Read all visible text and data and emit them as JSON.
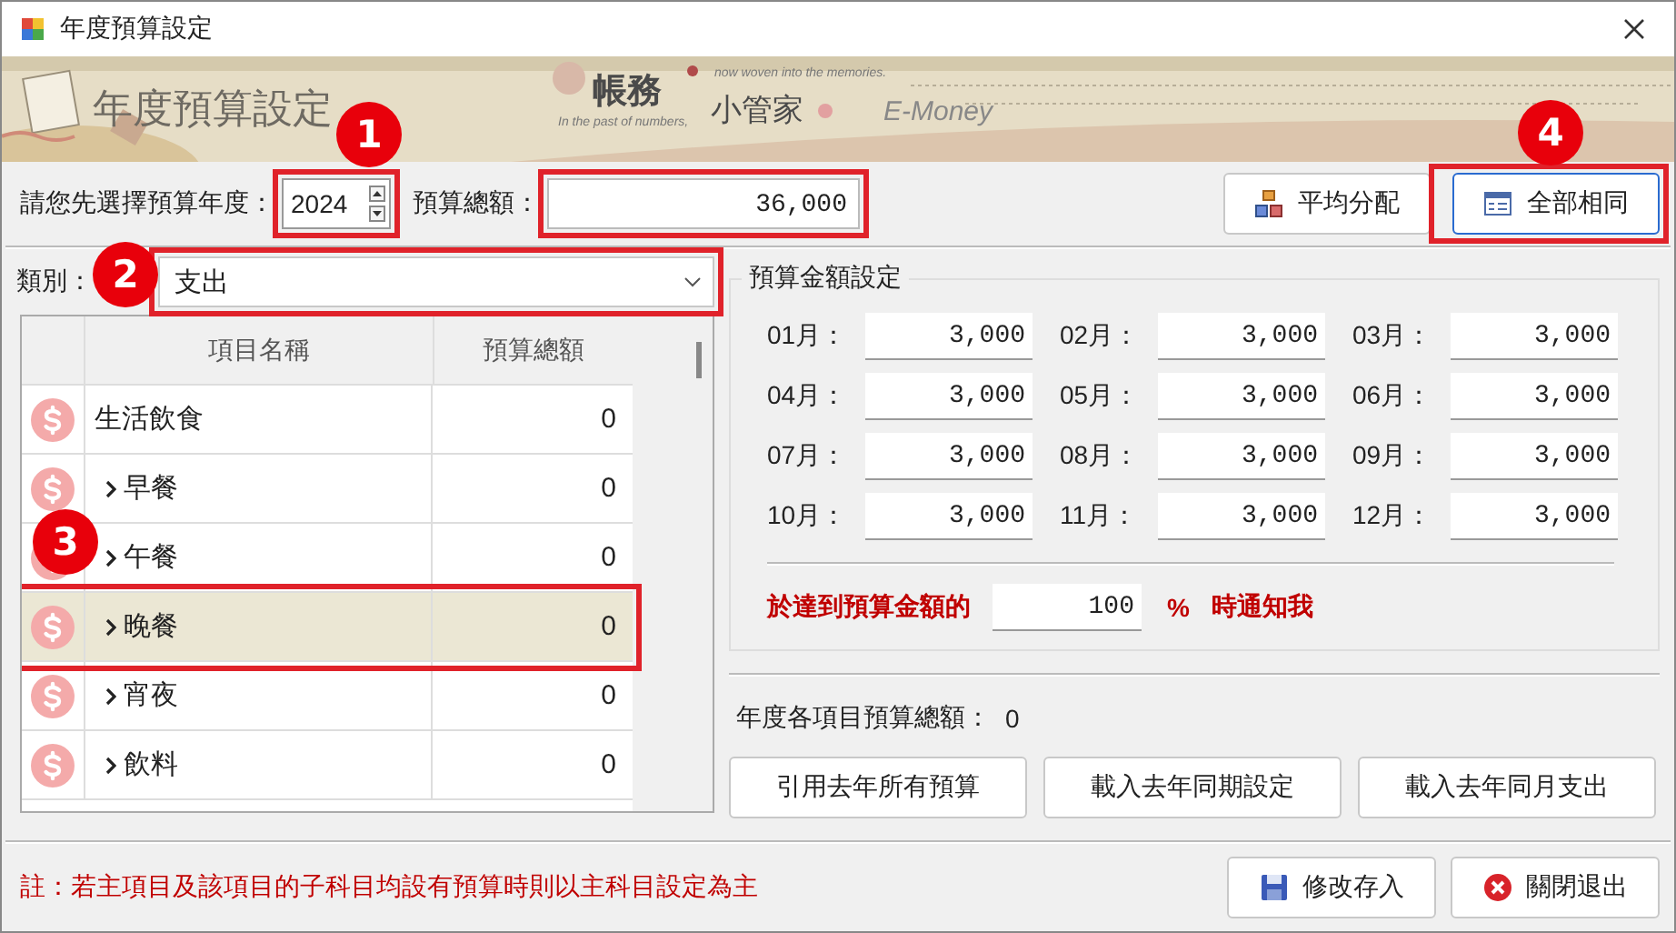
{
  "window": {
    "title": "年度預算設定"
  },
  "banner": {
    "title": "年度預算設定",
    "brand_1": "帳務",
    "brand_2": "小管家",
    "tagline_1": "now woven into the memories.",
    "tagline_2": "In the past of numbers,",
    "product": "E-Money"
  },
  "year": {
    "label": "請您先選擇預算年度：",
    "value": "2024",
    "highlighted": true,
    "callout": "1"
  },
  "total": {
    "label": "預算總額：",
    "value": "36,000",
    "highlighted": true
  },
  "toolbar_buttons": [
    {
      "label": "平均分配",
      "highlighted": false
    },
    {
      "label": "全部相同",
      "highlighted": true,
      "callout": "4"
    }
  ],
  "category": {
    "label": "類別：",
    "value": "支出",
    "highlighted": true,
    "callout": "2"
  },
  "table": {
    "columns": [
      "項目名稱",
      "預算總額"
    ],
    "rows": [
      {
        "name": "生活飲食",
        "amount": "0",
        "selected": false,
        "children": [
          {
            "name": "早餐",
            "amount": "0",
            "selected": false
          },
          {
            "name": "午餐",
            "amount": "0",
            "selected": false
          },
          {
            "name": "晚餐",
            "amount": "0",
            "selected": true,
            "highlighted": true,
            "callout": "3"
          },
          {
            "name": "宵夜",
            "amount": "0",
            "selected": false
          },
          {
            "name": "飲料",
            "amount": "0",
            "selected": false
          }
        ]
      }
    ]
  },
  "budget_group": {
    "title": "預算金額設定",
    "months": [
      {
        "label": "01月：",
        "value": "3,000"
      },
      {
        "label": "02月：",
        "value": "3,000"
      },
      {
        "label": "03月：",
        "value": "3,000"
      },
      {
        "label": "04月：",
        "value": "3,000"
      },
      {
        "label": "05月：",
        "value": "3,000"
      },
      {
        "label": "06月：",
        "value": "3,000"
      },
      {
        "label": "07月：",
        "value": "3,000"
      },
      {
        "label": "08月：",
        "value": "3,000"
      },
      {
        "label": "09月：",
        "value": "3,000"
      },
      {
        "label": "10月：",
        "value": "3,000"
      },
      {
        "label": "11月：",
        "value": "3,000"
      },
      {
        "label": "12月：",
        "value": "3,000"
      }
    ],
    "alert": {
      "prefix": "於達到預算金額的",
      "value": "100",
      "percent": "%",
      "suffix": "時通知我"
    }
  },
  "summary": {
    "label": "年度各項目預算總額：",
    "value": "0"
  },
  "actions": [
    "引用去年所有預算",
    "載入去年同期設定",
    "載入去年同月支出"
  ],
  "note": "註：若主項目及該項目的子科目均設有預算時則以主科目設定為主",
  "footer_buttons": [
    {
      "label": "修改存入"
    },
    {
      "label": "關閉退出"
    }
  ]
}
